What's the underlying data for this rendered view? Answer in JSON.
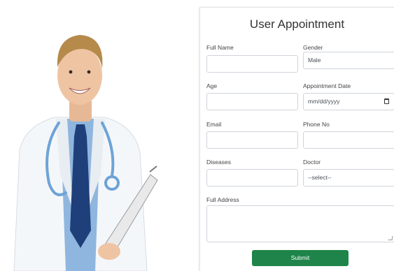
{
  "form": {
    "title": "User Appointment",
    "fields": {
      "full_name": {
        "label": "Full Name",
        "value": ""
      },
      "gender": {
        "label": "Gender",
        "value": "Male"
      },
      "age": {
        "label": "Age",
        "value": ""
      },
      "appointment_date": {
        "label": "Appointment Date",
        "placeholder": "mm/dd/yyyy"
      },
      "email": {
        "label": "Email",
        "value": ""
      },
      "phone": {
        "label": "Phone No",
        "value": ""
      },
      "diseases": {
        "label": "Diseases",
        "value": ""
      },
      "doctor": {
        "label": "Doctor",
        "value": "--select--"
      },
      "address": {
        "label": "Full Address",
        "value": ""
      }
    },
    "submit_label": "Submit"
  },
  "colors": {
    "submit_bg": "#1e8449",
    "coat": "#f4f7fa",
    "shirt": "#8fb6de",
    "tie": "#1f3f7a",
    "stethoscope": "#6ea3d6"
  },
  "icons": {
    "date_picker": "calendar-icon"
  }
}
